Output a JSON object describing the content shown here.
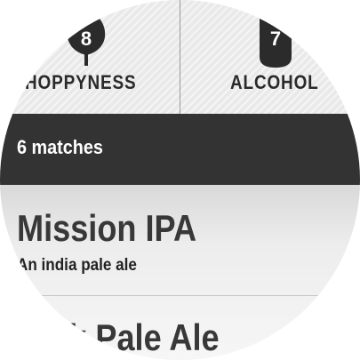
{
  "stats": {
    "hoppyness": {
      "label": "HOPPYNESS",
      "value": "8",
      "icon": "hop-icon"
    },
    "alcohol": {
      "label": "ALCOHOL",
      "value": "7",
      "icon": "bottle-icon"
    }
  },
  "matches": {
    "label": "6 matches"
  },
  "results": [
    {
      "name": "Mission IPA",
      "description": "An india pale ale"
    },
    {
      "name": "Park Pale Ale",
      "description": ""
    }
  ],
  "colors": {
    "header_bg": "#e9e9e9",
    "bar_bg": "#333333",
    "text_dark": "#383838",
    "text_light": "#ffffff"
  }
}
